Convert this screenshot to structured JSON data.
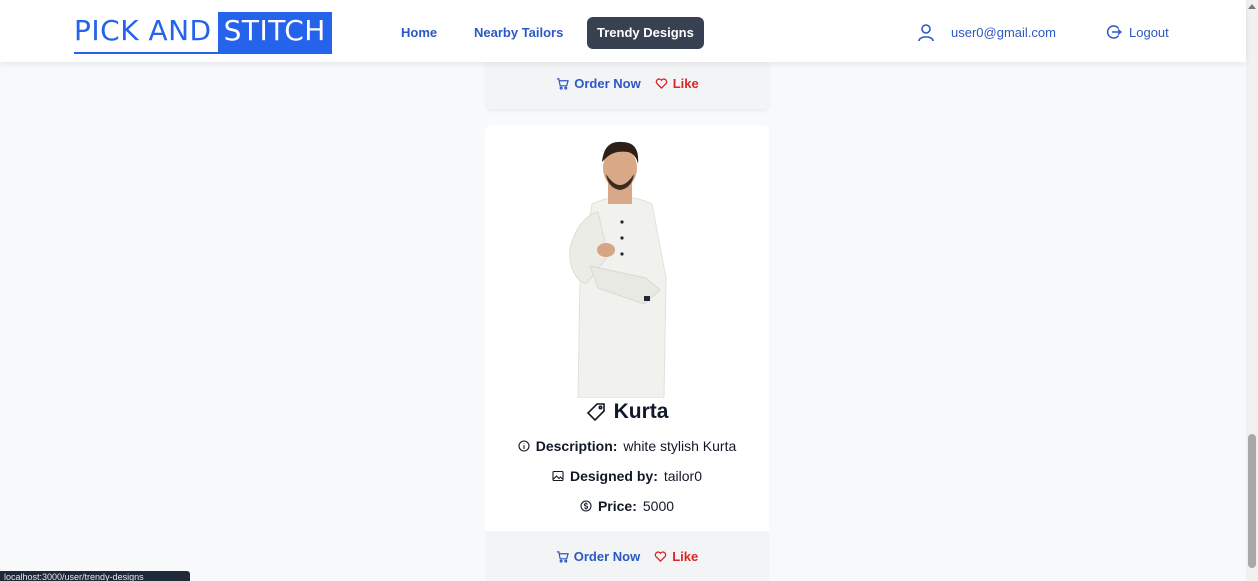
{
  "app": {
    "logo": {
      "part1": "PICK AND",
      "part2": "STITCH"
    },
    "nav": [
      {
        "label": "Home"
      },
      {
        "label": "Nearby Tailors"
      },
      {
        "label": "Trendy Designs",
        "active": true
      }
    ],
    "user": {
      "email": "user0@gmail.com",
      "icon": "user-icon"
    },
    "logout": {
      "label": "Logout",
      "icon": "logout-icon"
    },
    "colors": {
      "accent": "#2563eb",
      "link": "#2b58c4",
      "like": "#dc2626",
      "active_nav": "#374151"
    }
  },
  "actions": {
    "order_label": "Order Now",
    "like_label": "Like",
    "order_icon": "cart-icon",
    "like_icon": "heart-icon"
  },
  "product": {
    "title": "Kurta",
    "title_icon": "tag-icon",
    "description_label": "Description:",
    "description": "white stylish Kurta",
    "designer_label": "Designed by:",
    "designer": "tailor0",
    "price_label": "Price:",
    "price": "5000",
    "image": "man-in-white-kurta"
  },
  "status_bar": {
    "text": "localhost:3000/user/trendy-designs"
  }
}
